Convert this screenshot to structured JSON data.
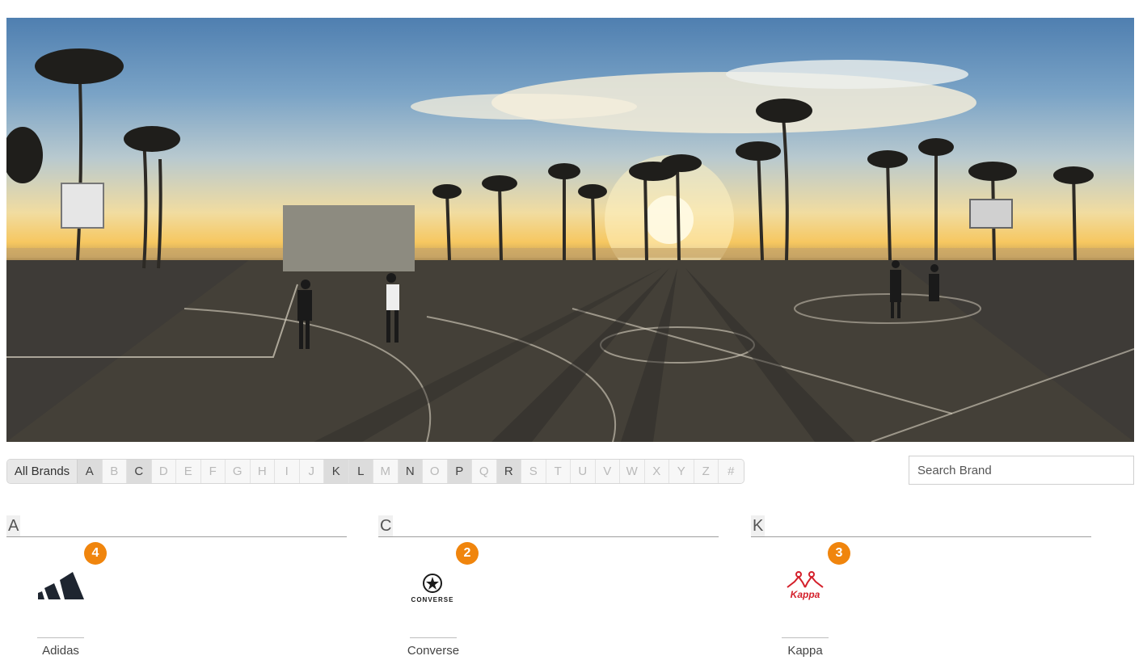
{
  "hero": {
    "image_icon": "beach-basketball-court-sunset-photo"
  },
  "alphabet": {
    "all_label": "All Brands",
    "letters": [
      {
        "label": "A",
        "active": true
      },
      {
        "label": "B",
        "active": false
      },
      {
        "label": "C",
        "active": true
      },
      {
        "label": "D",
        "active": false
      },
      {
        "label": "E",
        "active": false
      },
      {
        "label": "F",
        "active": false
      },
      {
        "label": "G",
        "active": false
      },
      {
        "label": "H",
        "active": false
      },
      {
        "label": "I",
        "active": false
      },
      {
        "label": "J",
        "active": false
      },
      {
        "label": "K",
        "active": true
      },
      {
        "label": "L",
        "active": true
      },
      {
        "label": "M",
        "active": false
      },
      {
        "label": "N",
        "active": true
      },
      {
        "label": "O",
        "active": false
      },
      {
        "label": "P",
        "active": true
      },
      {
        "label": "Q",
        "active": false
      },
      {
        "label": "R",
        "active": true
      },
      {
        "label": "S",
        "active": false
      },
      {
        "label": "T",
        "active": false
      },
      {
        "label": "U",
        "active": false
      },
      {
        "label": "V",
        "active": false
      },
      {
        "label": "W",
        "active": false
      },
      {
        "label": "X",
        "active": false
      },
      {
        "label": "Y",
        "active": false
      },
      {
        "label": "Z",
        "active": false
      },
      {
        "label": "#",
        "active": false
      }
    ]
  },
  "search": {
    "placeholder": "Search Brand"
  },
  "groups": [
    {
      "letter": "A",
      "brand": "Adidas",
      "count": "4",
      "logo_icon": "adidas-logo-icon"
    },
    {
      "letter": "C",
      "brand": "Converse",
      "count": "2",
      "logo_icon": "converse-logo-icon",
      "logo_text": "CONVERSE"
    },
    {
      "letter": "K",
      "brand": "Kappa",
      "count": "3",
      "logo_icon": "kappa-logo-icon",
      "logo_text": "Kappa"
    }
  ],
  "colors": {
    "badge": "#f0850d",
    "kappa_red": "#d4202b",
    "active_letter_bg": "#dcdcdc"
  }
}
